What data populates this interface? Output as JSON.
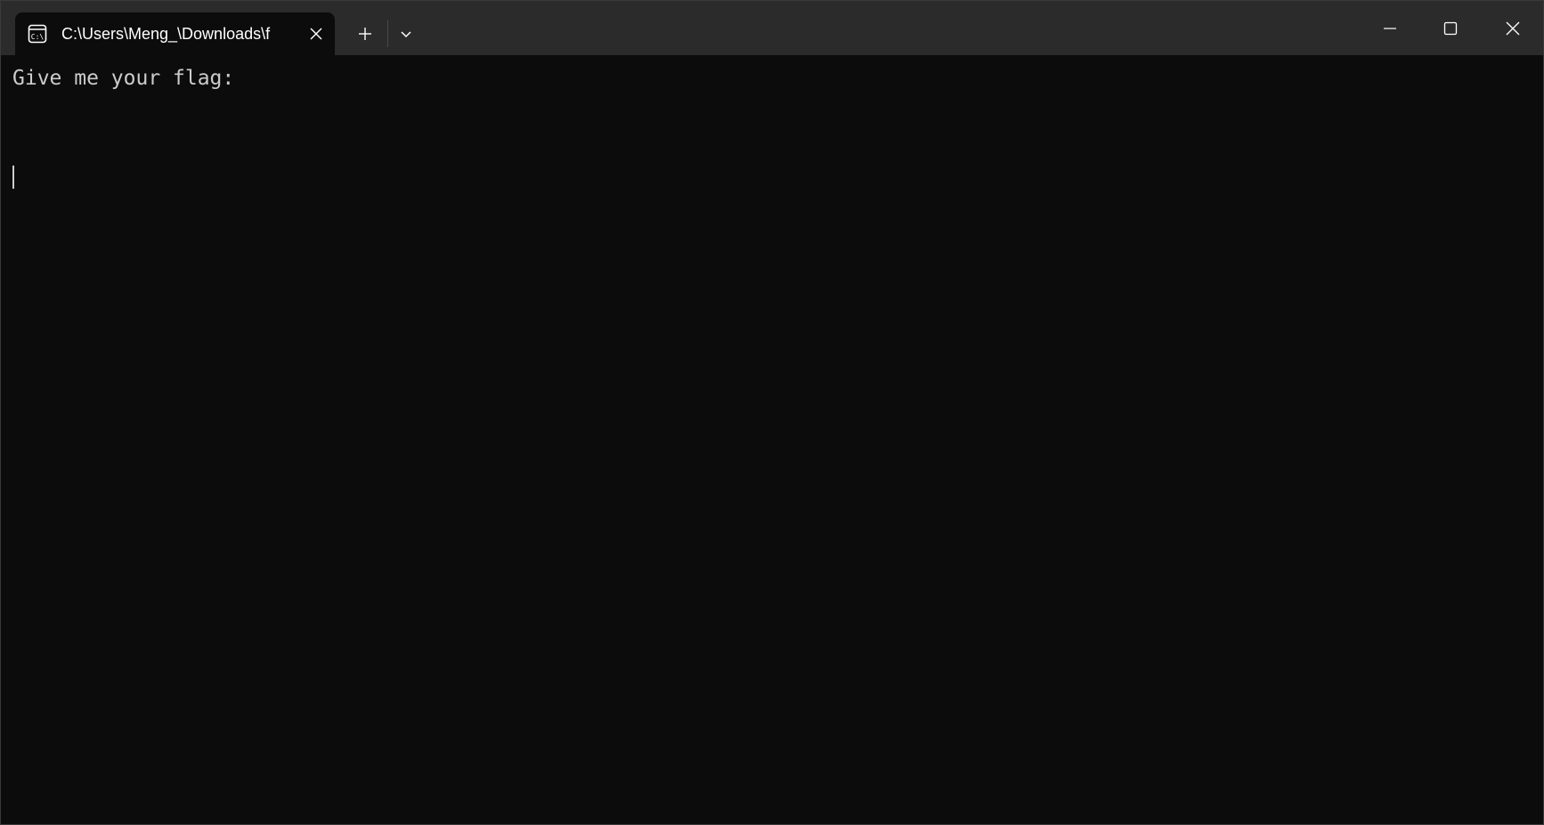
{
  "window": {
    "tab_title": "C:\\Users\\Meng_\\Downloads\\f",
    "tab_icon": "command-prompt-icon",
    "close_tab_icon": "close-icon",
    "new_tab_icon": "plus-icon",
    "dropdown_icon": "chevron-down-icon",
    "minimize_icon": "minimize-icon",
    "maximize_icon": "maximize-icon",
    "close_window_icon": "close-icon"
  },
  "terminal": {
    "lines": [
      "Give me your flag:"
    ],
    "input_value": ""
  },
  "colors": {
    "background": "#0c0c0c",
    "titlebar": "#2b2b2b",
    "text": "#cccccc"
  }
}
